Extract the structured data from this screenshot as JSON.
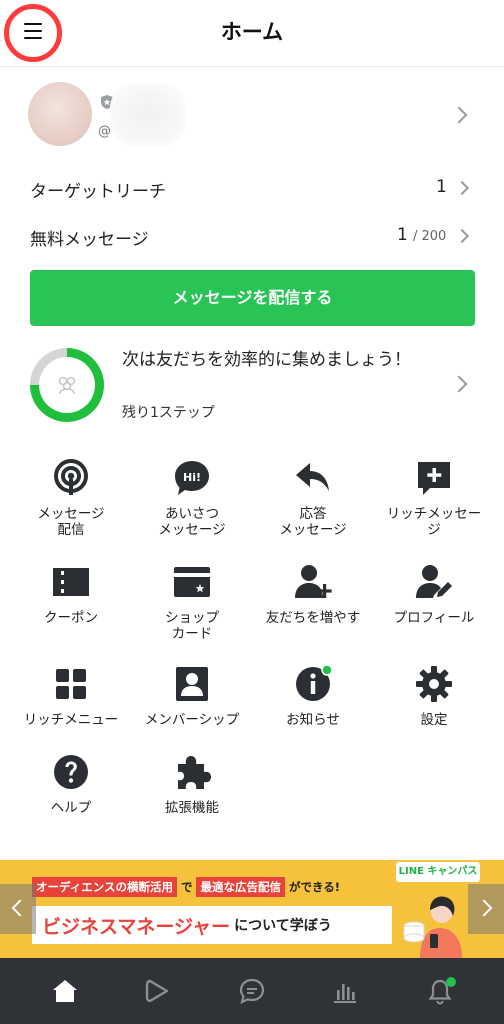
{
  "header": {
    "title": "ホーム"
  },
  "profile": {
    "at_symbol": "@"
  },
  "stats": {
    "target_reach_label": "ターゲットリーチ",
    "target_reach_value": "1",
    "free_messages_label": "無料メッセージ",
    "free_messages_value": "1",
    "free_messages_limit": "/ 200"
  },
  "cta": {
    "label": "メッセージを配信する"
  },
  "progress": {
    "title": "次は友だちを効率的に集めましょう！",
    "subtitle": "残り1ステップ",
    "fraction": 0.75
  },
  "features": [
    {
      "label": "メッセージ\n配信",
      "icon": "broadcast-icon"
    },
    {
      "label": "あいさつ\nメッセージ",
      "icon": "hi-bubble-icon"
    },
    {
      "label": "応答\nメッセージ",
      "icon": "reply-arrow-icon"
    },
    {
      "label": "リッチメッセー\nジ",
      "icon": "rich-message-icon"
    },
    {
      "label": "クーポン",
      "icon": "coupon-icon"
    },
    {
      "label": "ショップ\nカード",
      "icon": "shop-card-icon"
    },
    {
      "label": "友だちを増やす",
      "icon": "add-friend-icon"
    },
    {
      "label": "プロフィール",
      "icon": "profile-edit-icon"
    },
    {
      "label": "リッチメニュー",
      "icon": "rich-menu-icon"
    },
    {
      "label": "メンバーシップ",
      "icon": "membership-icon"
    },
    {
      "label": "お知らせ",
      "icon": "info-icon"
    },
    {
      "label": "設定",
      "icon": "gear-icon"
    },
    {
      "label": "ヘルプ",
      "icon": "help-icon"
    },
    {
      "label": "拡張機能",
      "icon": "puzzle-icon"
    }
  ],
  "banner": {
    "tag": "LINE キャンパス",
    "line1_a": "オーディエンスの横断活用",
    "line1_b": "で",
    "line1_c": "最適な広告配信",
    "line1_d": "ができる!",
    "line2_a": "ビジネスマネージャー",
    "line2_b": "について学ぼう"
  },
  "colors": {
    "accent_green": "#28c455",
    "highlight_red": "#ff3b3b",
    "banner_yellow": "#f6c23c",
    "nav_bg": "#2f3237"
  },
  "bottom_nav": [
    "home-icon",
    "voom-play-icon",
    "chat-icon",
    "analytics-icon",
    "notification-bell-icon"
  ]
}
